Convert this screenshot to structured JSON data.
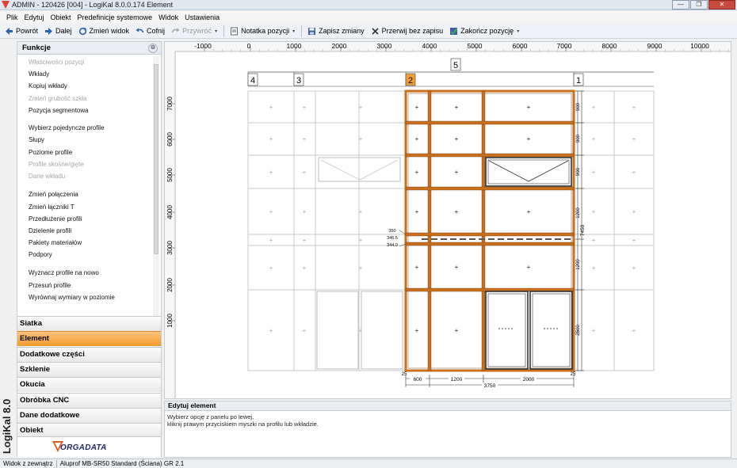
{
  "window": {
    "title": "ADMIN - 120426 [004] - LogiKal 8.0.0.174 Element",
    "buttons": {
      "minimize": "—",
      "maximize": "❐",
      "close": "✕"
    }
  },
  "menu": [
    "Plik",
    "Edytuj",
    "Obiekt",
    "Predefinicje systemowe",
    "Widok",
    "Ustawienia"
  ],
  "toolbar": {
    "back": "Powrót",
    "next": "Dalej",
    "change_view": "Zmień widok",
    "undo": "Cofnij",
    "redo": "Przywróć",
    "note": "Notatka pozycji",
    "save": "Zapisz zmiany",
    "abort": "Przerwij bez zapisu",
    "finish": "Zakończ pozycję"
  },
  "left_panel": {
    "header": "Funkcje",
    "functions": [
      {
        "label": "Właściwości pozycji",
        "enabled": false
      },
      {
        "label": "Wkłady",
        "enabled": true
      },
      {
        "label": "Kopiuj wkłady",
        "enabled": true
      },
      {
        "label": "Zmień grubość szkła",
        "enabled": false
      },
      {
        "label": "Pozycja segmentowa",
        "enabled": true
      },
      {
        "label": "Wybierz pojedyncze profile",
        "enabled": true
      },
      {
        "label": "Słupy",
        "enabled": true
      },
      {
        "label": "Poziome profile",
        "enabled": true
      },
      {
        "label": "Profile skośne/gięte",
        "enabled": false
      },
      {
        "label": "Dane wkładu",
        "enabled": false
      },
      {
        "label": "Zmień połączenia",
        "enabled": true
      },
      {
        "label": "Zmień łączniki T",
        "enabled": true
      },
      {
        "label": "Przedłużenie profili",
        "enabled": true
      },
      {
        "label": "Dzielenie profili",
        "enabled": true
      },
      {
        "label": "Pakiety materiałów",
        "enabled": true
      },
      {
        "label": "Podpory",
        "enabled": true
      },
      {
        "label": "Wyznacz profile na nowo",
        "enabled": true
      },
      {
        "label": "Przesuń profile",
        "enabled": true
      },
      {
        "label": "Wyrównaj wymiary w poziomie",
        "enabled": true
      }
    ],
    "sections": [
      {
        "label": "Siatka",
        "active": false
      },
      {
        "label": "Element",
        "active": true
      },
      {
        "label": "Dodatkowe części",
        "active": false
      },
      {
        "label": "Szklenie",
        "active": false
      },
      {
        "label": "Okucia",
        "active": false
      },
      {
        "label": "Obróbka CNC",
        "active": false
      },
      {
        "label": "Dane dodatkowe",
        "active": false
      },
      {
        "label": "Obiekt",
        "active": false
      }
    ],
    "brand_logo": "ORGADATA",
    "brand_side": "LogiKal 8.0"
  },
  "drawing": {
    "ruler_top": [
      "-1000",
      "0",
      "1000",
      "2000",
      "3000",
      "4000",
      "5000",
      "6000",
      "7000",
      "8000",
      "9000",
      "10000"
    ],
    "ruler_left": [
      "7000",
      "6000",
      "5000",
      "4000",
      "3000",
      "2000",
      "1000"
    ],
    "segment_labels": [
      "4",
      "3",
      "2",
      "1",
      "5"
    ],
    "dims_bottom": [
      "600",
      "1200",
      "2000",
      "3750"
    ],
    "dims_side": [
      "900",
      "900",
      "900",
      "1200",
      "1200",
      "2500",
      "7450"
    ],
    "dims_small": [
      "350",
      "346.5",
      "344.0"
    ],
    "dims_edge": [
      "25",
      "25"
    ],
    "accent": "#c8701e"
  },
  "info": {
    "title": "Edytuj element",
    "line1": "Wybierz opcję z panelu po lewej,",
    "line2": "kliknij prawym przyciskiem myszki na profilu lub wkładzie."
  },
  "status": {
    "view": "Widok z zewnątrz",
    "system": "Aluprof MB-SR50 Standard (Ściana) GR 2.1"
  }
}
